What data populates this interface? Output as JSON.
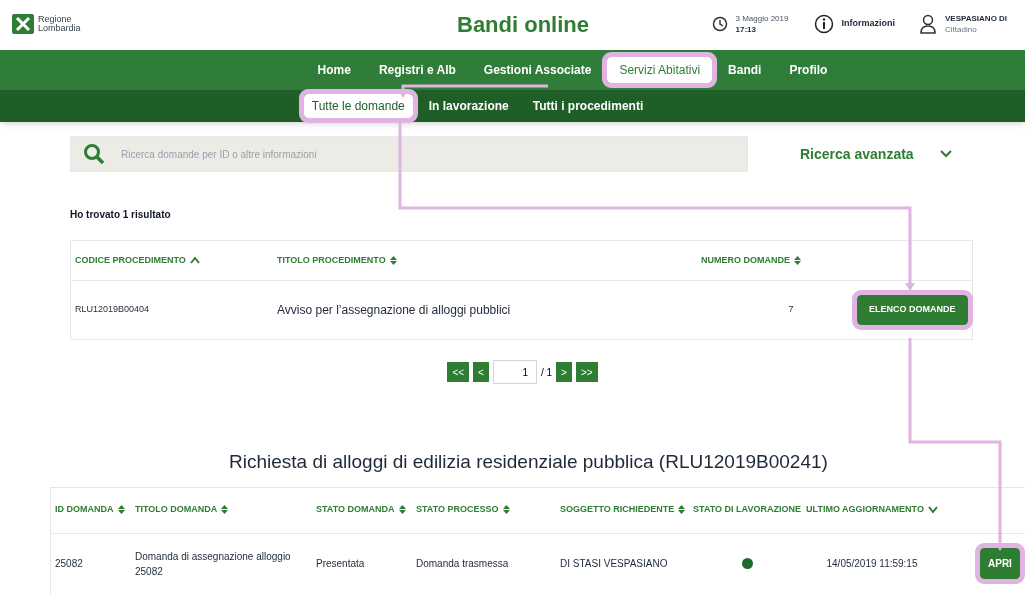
{
  "header": {
    "logo_line_1": "Regione",
    "logo_line_2": "Lombardia",
    "title": "Bandi online",
    "date": "3 Maggio 2019",
    "time": "17:13",
    "info": "Informazioni",
    "user_name": "VESPASIANO DI",
    "user_role": "Cittadino"
  },
  "nav": [
    {
      "label": "Home",
      "selected": false,
      "highlighted": false
    },
    {
      "label": "Registri e Alb",
      "selected": false,
      "highlighted": false
    },
    {
      "label": "Gestioni Associate",
      "selected": false,
      "highlighted": false
    },
    {
      "label": "Servizi Abitativi",
      "selected": true,
      "highlighted": true
    },
    {
      "label": "Bandi",
      "selected": false,
      "highlighted": false
    },
    {
      "label": "Profilo",
      "selected": false,
      "highlighted": false
    }
  ],
  "subnav": [
    {
      "label": "Tutte le domande",
      "selected": true,
      "highlighted": true
    },
    {
      "label": "In lavorazione",
      "selected": false,
      "highlighted": false
    },
    {
      "label": "Tutti i procedimenti",
      "selected": false,
      "highlighted": false
    }
  ],
  "search": {
    "placeholder": "Ricerca domande per ID o altre informazioni",
    "advanced": "Ricerca avanzata"
  },
  "result_count": "Ho trovato 1 risultato",
  "table": {
    "columns": [
      {
        "label": "CODICE PROCEDIMENTO",
        "kind": "ascending"
      },
      {
        "label": "TITOLO PROCEDIMENTO",
        "kind": "sortable"
      },
      {
        "label": "NUMERO DOMANDE",
        "kind": "sortable"
      }
    ],
    "rows": [
      {
        "code": "RLU12019B00404",
        "title": "Avviso per l’assegnazione di alloggi pubblici",
        "count": "7",
        "action": "ELENCO DOMANDE",
        "highlighted": true
      }
    ]
  },
  "pagination": {
    "first": "<<",
    "prev": "<",
    "page": "1",
    "total": "/ 1",
    "next": ">",
    "last": ">>"
  },
  "detail": {
    "title": "Richiesta di alloggi di edilizia residenziale pubblica (RLU12019B00241)",
    "columns": [
      {
        "label": "ID DOMANDA",
        "kind": "sortable"
      },
      {
        "label": "TITOLO DOMANDA",
        "kind": "sortable"
      },
      {
        "label": "STATO DOMANDA",
        "kind": "sortable"
      },
      {
        "label": "STATO PROCESSO",
        "kind": "sortable"
      },
      {
        "label": "SOGGETTO RICHIEDENTE",
        "kind": "sortable"
      },
      {
        "label": "STATO DI LAVORAZIONE",
        "kind": "plain"
      },
      {
        "label": "ULTIMO AGGIORNAMENTO",
        "kind": "descending"
      }
    ],
    "rows": [
      {
        "id": "25082",
        "title": "Domanda di assegnazione alloggio 25082",
        "state": "Presentata",
        "process": "Domanda trasmessa",
        "applicant": "DI STASI VESPASIANO",
        "color": "#1e6b2a",
        "updated": "14/05/2019 11:59:15",
        "action": "APRI",
        "highlighted": true
      }
    ]
  }
}
